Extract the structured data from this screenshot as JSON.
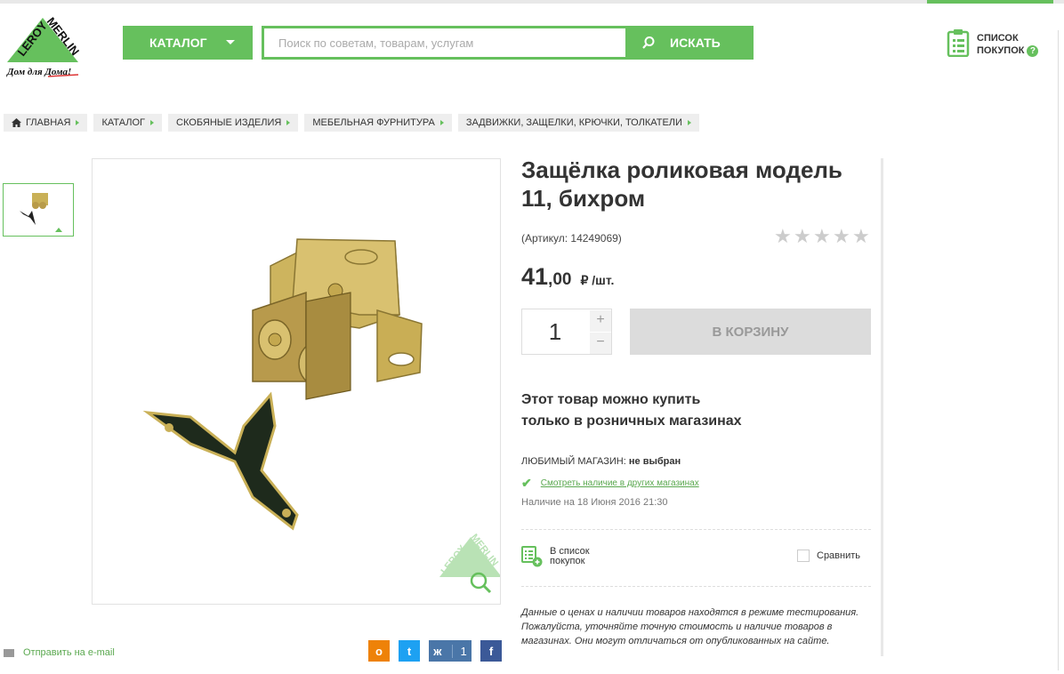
{
  "brand": {
    "logo_text": "LEROY MERLIN",
    "slogan": "Дом для Дома!"
  },
  "header": {
    "catalog_label": "КАТАЛОГ",
    "search_placeholder": "Поиск по советам, товарам, услугам",
    "search_value": "",
    "search_button": "ИСКАТЬ",
    "shopping_list_line1": "СПИСОК",
    "shopping_list_line2": "ПОКУПОК",
    "help_glyph": "?"
  },
  "breadcrumbs": [
    "ГЛАВНАЯ",
    "КАТАЛОГ",
    "СКОБЯНЫЕ ИЗДЕЛИЯ",
    "МЕБЕЛЬНАЯ ФУРНИТУРА",
    "ЗАДВИЖКИ, ЗАЩЕЛКИ, КРЮЧКИ, ТОЛКАТЕЛИ"
  ],
  "product": {
    "title": "Защёлка роликовая модель 11, бихром",
    "article": "(Артикул: 14249069)",
    "rating": 0,
    "rating_max": 5,
    "price_int": "41",
    "price_frac": ",00",
    "price_unit": "₽ /шт.",
    "quantity": "1",
    "plus": "+",
    "minus": "−",
    "cart_button": "В КОРЗИНУ",
    "retail_only_line1": "Этот товар можно купить",
    "retail_only_line2": "только в розничных магазинах",
    "fav_store_label": "ЛЮБИМЫЙ МАГАЗИН:",
    "fav_store_value": "не выбран",
    "check_other_stores": "Смотреть наличие в других магазинах",
    "availability_date": "Наличие на 18 Июня 2016 21:30",
    "add_to_list_line1": "В список",
    "add_to_list_line2": "покупок",
    "compare": "Сравнить",
    "disclaimer": "Данные о ценах и наличии товаров находятся в режиме тестирования. Пожалуйста, уточняйте точную стоимость и наличие товаров в магазинах. Они могут отличаться от опубликованных на сайте."
  },
  "footer": {
    "email_link": "Отправить на e-mail",
    "vk_count": "1"
  },
  "colors": {
    "accent": "#66c05d",
    "disabled_button": "#dcdcdc"
  },
  "icons": [
    "home-icon",
    "search-icon",
    "clipboard-icon",
    "star-icon",
    "check-icon",
    "list-add-icon",
    "zoom-icon",
    "envelope-icon"
  ]
}
